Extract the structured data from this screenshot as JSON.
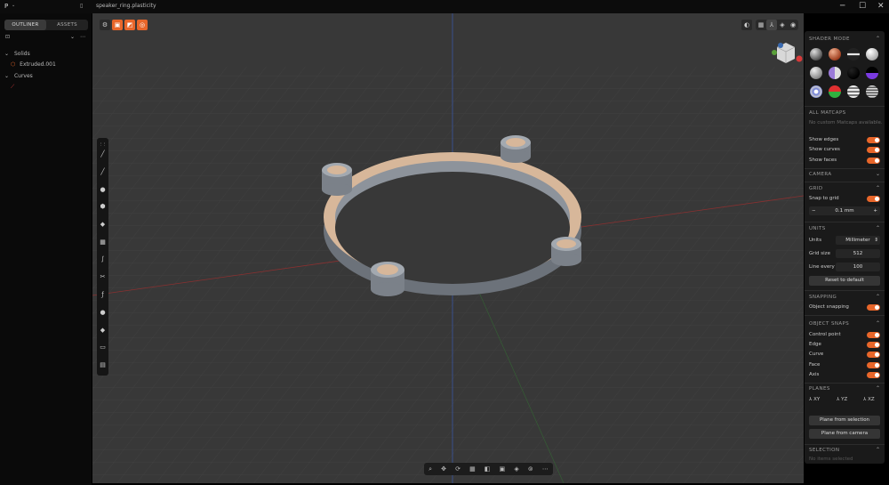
{
  "titlebar": {
    "app_glyph": "P",
    "filename": "speaker_ring.plasticity",
    "minimize": "─",
    "maximize": "☐",
    "close": "✕"
  },
  "sidebar": {
    "tabs": [
      "OUTLINER",
      "ASSETS"
    ],
    "groups": [
      {
        "label": "Solids",
        "items": [
          "Extruded.001"
        ]
      },
      {
        "label": "Curves",
        "items": []
      }
    ]
  },
  "viewport": {
    "top_buttons": [
      "⚙",
      "▣",
      "◩",
      "◎"
    ],
    "right_buttons": [
      "◐",
      "▦",
      "⅄",
      "◈",
      "◉"
    ],
    "bottom_tools": [
      "⌕",
      "✥",
      "⟳",
      "▦",
      "◧",
      "▣",
      "◈",
      "⊚",
      "⋯"
    ],
    "left_tools": [
      "⋮⋮",
      "╱",
      "╱",
      "●",
      "⬢",
      "◆",
      "▦",
      "∫",
      "✂",
      "ƒ",
      "●",
      "◆",
      "▭",
      "▤"
    ]
  },
  "panel": {
    "shader_mode": "SHADER MODE",
    "all_matcaps": "ALL MATCAPS",
    "no_matcaps": "No custom Matcaps available.",
    "show_edges": "Show edges",
    "show_curves": "Show curves",
    "show_faces": "Show faces",
    "camera": "CAMERA",
    "grid": "GRID",
    "snap_to_grid": "Snap to grid",
    "grid_value": "0.1 mm",
    "units": "UNITS",
    "units_label": "Units",
    "units_value": "Millimeter",
    "grid_size_label": "Grid size",
    "grid_size_value": "512",
    "line_every_label": "Line every",
    "line_every_value": "100",
    "reset": "Reset to default",
    "snapping": "SNAPPING",
    "object_snapping": "Object snapping",
    "object_snaps": "OBJECT SNAPS",
    "snaps": [
      "Control point",
      "Edge",
      "Curve",
      "Face",
      "Axis"
    ],
    "planes": "PLANES",
    "plane_labels": [
      "XY",
      "YZ",
      "XZ"
    ],
    "plane_from_selection": "Plane from selection",
    "plane_from_camera": "Plane from camera",
    "selection": "SELECTION",
    "no_selection": "No items selected"
  }
}
